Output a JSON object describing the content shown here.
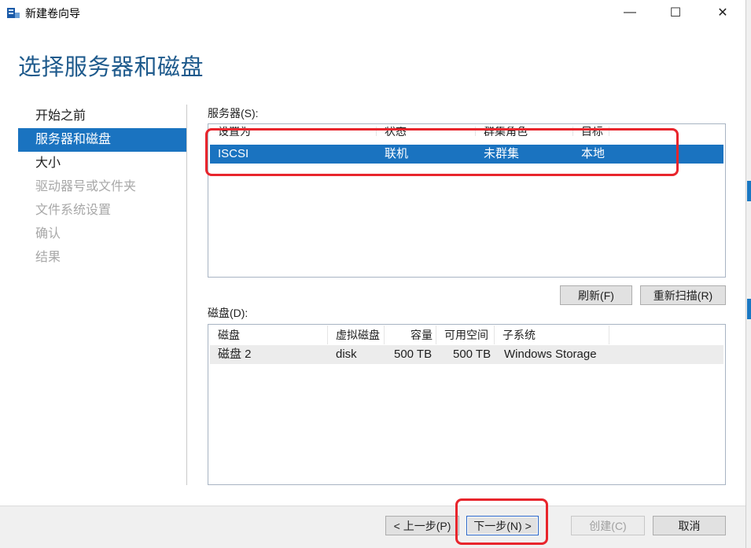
{
  "window": {
    "title": "新建卷向导"
  },
  "headline": "选择服务器和磁盘",
  "nav": {
    "items": [
      {
        "label": "开始之前",
        "state": "normal"
      },
      {
        "label": "服务器和磁盘",
        "state": "active"
      },
      {
        "label": "大小",
        "state": "normal"
      },
      {
        "label": "驱动器号或文件夹",
        "state": "disabled"
      },
      {
        "label": "文件系统设置",
        "state": "disabled"
      },
      {
        "label": "确认",
        "state": "disabled"
      },
      {
        "label": "结果",
        "state": "disabled"
      }
    ]
  },
  "servers": {
    "label": "服务器(S):",
    "columns": [
      "设置为",
      "状态",
      "群集角色",
      "目标"
    ],
    "rows": [
      [
        "ISCSI",
        "联机",
        "未群集",
        "本地"
      ]
    ]
  },
  "buttons": {
    "refresh": "刷新(F)",
    "rescan": "重新扫描(R)"
  },
  "disks": {
    "label": "磁盘(D):",
    "columns": [
      "磁盘",
      "虚拟磁盘",
      "容量",
      "可用空间",
      "子系统"
    ],
    "rows": [
      [
        "磁盘 2",
        "disk",
        "500 TB",
        "500 TB",
        "Windows Storage"
      ]
    ]
  },
  "footer": {
    "prev": "< 上一步(P)",
    "next": "下一步(N) >",
    "create": "创建(C)",
    "cancel": "取消"
  },
  "colors": {
    "accent": "#1a73c0",
    "headline": "#1e5a8c",
    "highlight": "#e8252c"
  },
  "window_controls": {
    "minimize": "—",
    "maximize": "☐",
    "close": "✕"
  }
}
